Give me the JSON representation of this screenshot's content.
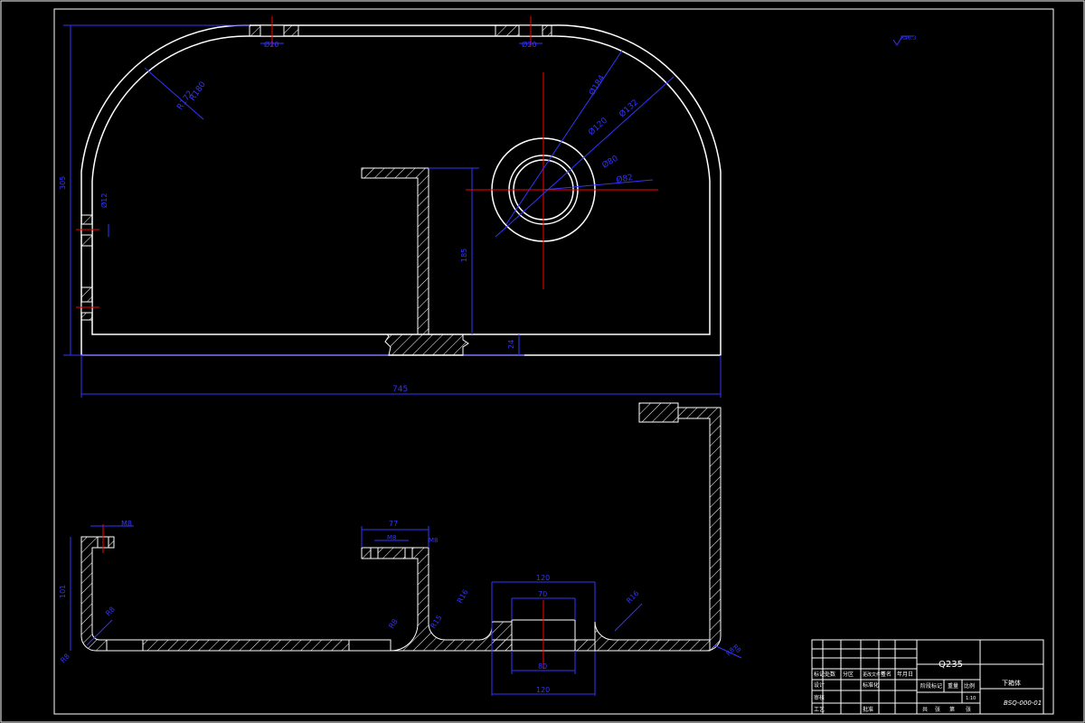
{
  "drawing": {
    "roughness_mark": "Ra6.3",
    "top_view": {
      "dim_top_left_hole": "Ø20",
      "dim_top_right_hole": "Ø20",
      "dim_outer_radius": "R180",
      "dim_inner_radius": "R172",
      "dim_height": "305",
      "dim_side_hole": "Ø12",
      "dim_inner_height": "185",
      "dim_base_thickness": "24",
      "dim_circle_1": "Ø184",
      "dim_circle_2": "Ø132",
      "dim_circle_3": "Ø120",
      "dim_circle_4": "Ø80",
      "dim_circle_5": "Ø82",
      "dim_width": "745"
    },
    "section_view": {
      "dim_left_thread": "M8",
      "dim_left_height": "101",
      "dim_left_radius": "R8",
      "dim_left_chamfer": "R8",
      "dim_top_width": "77",
      "dim_mid_thread": "M8",
      "dim_mid_thread_2": "M8",
      "dim_boss_top": "120",
      "dim_boss_bore": "70",
      "dim_boss_bottom": "80",
      "dim_boss_base": "120",
      "dim_r_a": "R16",
      "dim_r_b": "R15",
      "dim_r_c": "R8",
      "dim_r_d": "R16",
      "dim_r_e": "R8",
      "dim_r_f": "R8"
    }
  },
  "title_block": {
    "material": "Q235",
    "part_name": "下箱体",
    "drawing_number": "BSQ-000-01",
    "cells": {
      "r1c1": "标记",
      "r1c2": "处数",
      "r1c3": "分区",
      "r1c4": "更改文件号",
      "r1c5": "签名",
      "r1c6": "年月日",
      "r2c1": "设计",
      "r2c2": "",
      "r2c3": "标准化",
      "r3c1": "审核",
      "r4c1": "工艺",
      "r4c2": "批准",
      "stage": "阶段标记",
      "weight": "重量",
      "scale": "比例",
      "scale_value": "1:10",
      "sheet_total": "共",
      "sheet_label": "张",
      "sheet_this": "第",
      "sheet_label2": "张"
    }
  },
  "colors": {
    "background": "#000000",
    "outline": "#ffffff",
    "dimension": "#3333ff",
    "centerline": "#ff0000",
    "text": "#ffffff"
  }
}
